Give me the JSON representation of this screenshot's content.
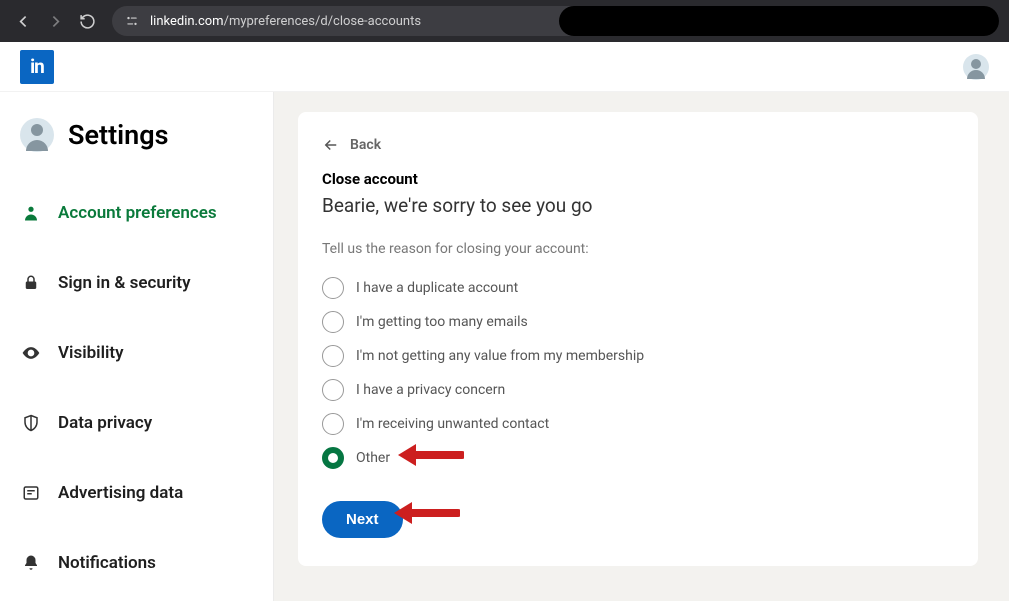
{
  "browser": {
    "url_domain": "linkedin.com",
    "url_path": "/mypreferences/d/close-accounts"
  },
  "header": {
    "logo_text": "in"
  },
  "sidebar": {
    "title": "Settings",
    "items": [
      {
        "label": "Account preferences",
        "icon": "person-icon",
        "active": true
      },
      {
        "label": "Sign in & security",
        "icon": "lock-icon",
        "active": false
      },
      {
        "label": "Visibility",
        "icon": "eye-icon",
        "active": false
      },
      {
        "label": "Data privacy",
        "icon": "shield-icon",
        "active": false
      },
      {
        "label": "Advertising data",
        "icon": "doc-icon",
        "active": false
      },
      {
        "label": "Notifications",
        "icon": "bell-icon",
        "active": false
      }
    ]
  },
  "main": {
    "back_label": "Back",
    "title": "Close account",
    "subtitle": "Bearie, we're sorry to see you go",
    "reason_prompt": "Tell us the reason for closing your account:",
    "reasons": [
      {
        "label": "I have a duplicate account",
        "selected": false
      },
      {
        "label": "I'm getting too many emails",
        "selected": false
      },
      {
        "label": "I'm not getting any value from my membership",
        "selected": false
      },
      {
        "label": "I have a privacy concern",
        "selected": false
      },
      {
        "label": "I'm receiving unwanted contact",
        "selected": false
      },
      {
        "label": "Other",
        "selected": true
      }
    ],
    "next_label": "Next"
  }
}
